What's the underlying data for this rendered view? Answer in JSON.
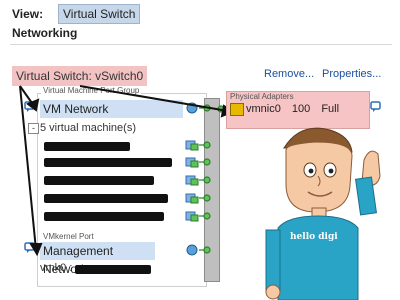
{
  "header": {
    "view_label": "View:",
    "view_value": "Virtual Switch",
    "section_title": "Networking"
  },
  "vswitch": {
    "title": "Virtual Switch: vSwitch0",
    "remove_label": "Remove...",
    "properties_label": "Properties..."
  },
  "vm_port_group": {
    "group_label": "Virtual Machine Port Group",
    "name": "VM Network",
    "vm_count": "5 virtual machine(s)",
    "collapse_symbol": "-"
  },
  "vmkernel": {
    "group_label": "VMkernel Port",
    "name": "Management Network",
    "vmk_label": "vmk0 :"
  },
  "physical_adapters": {
    "group_label": "Physical Adapters",
    "nic": "vmnic0",
    "speed": "100",
    "duplex": "Full"
  },
  "illustration": {
    "shirt_text": "hello digi"
  },
  "colors": {
    "highlight_red": "#f3c3c3",
    "selection_blue": "#cfe0f4",
    "link_blue": "#1a4f9e",
    "bus_gray": "#bfbfbf",
    "shirt_teal": "#29a3c6"
  }
}
